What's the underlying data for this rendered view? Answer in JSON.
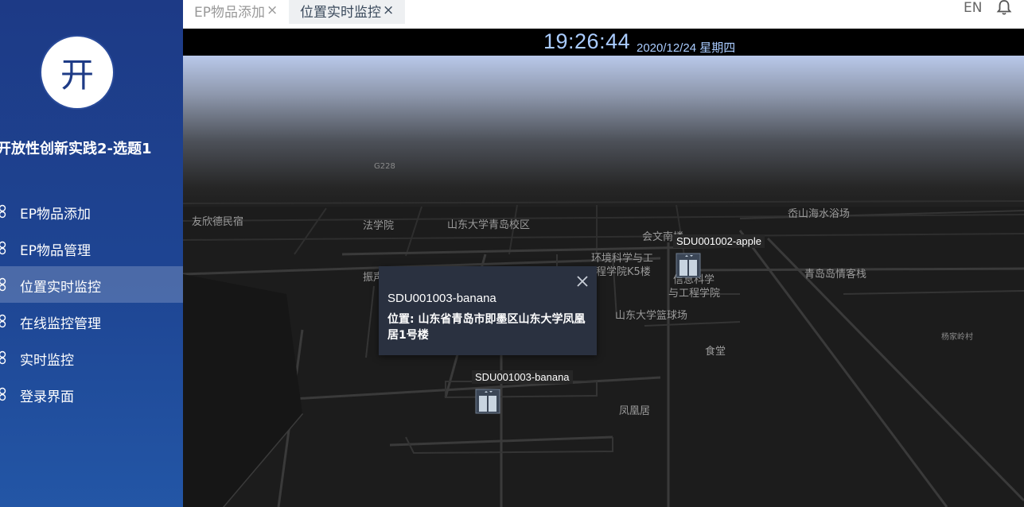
{
  "sidebar": {
    "avatar_char": "开",
    "app_title": "开放性创新实践2-选题1",
    "items": [
      {
        "label": "EP物品添加",
        "active": false
      },
      {
        "label": "EP物品管理",
        "active": false
      },
      {
        "label": "位置实时监控",
        "active": true
      },
      {
        "label": "在线监控管理",
        "active": false
      },
      {
        "label": "实时监控",
        "active": false
      },
      {
        "label": "登录界面",
        "active": false
      }
    ]
  },
  "header": {
    "tabs": [
      {
        "label": "EP物品添加",
        "close": "×"
      },
      {
        "label": "位置实时监控",
        "close": "×"
      }
    ],
    "lang": "EN"
  },
  "clock": {
    "time": "19:26:44",
    "date": "2020/12/24 星期四"
  },
  "map": {
    "labels": {
      "g228": "G228",
      "youxin": "友欣德民宿",
      "faxueyuan": "法学院",
      "sdu_qd": "山东大学青岛校区",
      "zhenhuan": "振声苑东楼",
      "huiwen": "会文南楼",
      "huanjing1": "环境科学与工",
      "huanjing2": "程学院K5楼",
      "xinxi1": "信息科学",
      "xinxi2": "与工程学院",
      "lanqiu": "山东大学篮球场",
      "shitang": "食堂",
      "fenghuangju": "凤凰居",
      "jishan": "岙山海水浴场",
      "qingdaodao": "青岛岛情客栈",
      "yangjia": "杨家岭村"
    },
    "markers": [
      {
        "label": "SDU001002-apple"
      },
      {
        "label": "SDU001003-banana"
      }
    ],
    "popup": {
      "title": "SDU001003-banana",
      "body": "位置: 山东省青岛市即墨区山东大学凤凰居1号楼"
    }
  },
  "colors": {
    "sidebar": "#1e4593",
    "clock_text": "#aaccff",
    "map_bg": "#1c1c1c",
    "popup_bg": "#2a3140"
  },
  "icons": {
    "menu": "link-icon",
    "bell": "bell-icon",
    "close": "close-icon",
    "marker": "elevator-icon"
  }
}
